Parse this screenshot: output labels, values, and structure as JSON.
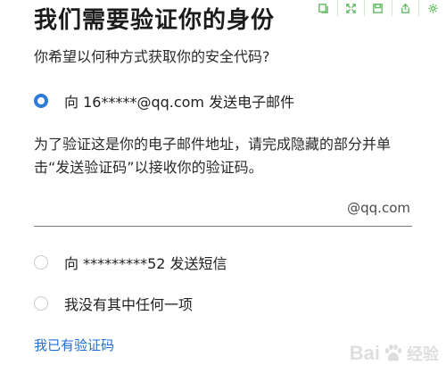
{
  "header": {
    "title": "我们需要验证你的身份"
  },
  "toolbar": {
    "icons": [
      "copy-icon",
      "fullscreen-icon",
      "save-icon",
      "share-icon",
      "settings-icon"
    ]
  },
  "question": "你希望以何种方式获取你的安全代码?",
  "options": [
    {
      "label": "向 16*****@qq.com 发送电子邮件",
      "selected": true
    },
    {
      "label": "向 *********52 发送短信",
      "selected": false
    },
    {
      "label": "我没有其中任何一项",
      "selected": false
    }
  ],
  "instruction": "为了验证这是你的电子邮件地址，请完成隐藏的部分并单击“发送验证码”以接收你的验证码。",
  "email_input": {
    "value": "",
    "placeholder": "",
    "suffix": "@qq.com"
  },
  "have_code_link": "我已有验证码",
  "watermark": {
    "text": "Bai",
    "text2": "经验"
  },
  "colors": {
    "accent": "#2f7ad6",
    "link": "#1f6fd1",
    "toolbar": "#6bbf6b"
  }
}
